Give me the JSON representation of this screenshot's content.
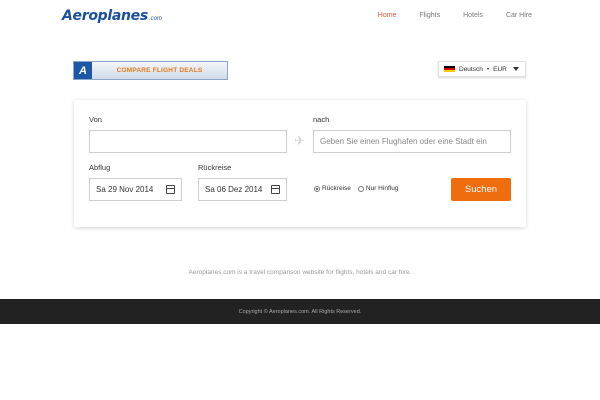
{
  "header": {
    "logo_main": "Aeroplanes",
    "logo_domain": ".com",
    "nav": [
      {
        "label": "Home",
        "active": true
      },
      {
        "label": "Flights",
        "active": false
      },
      {
        "label": "Hotels",
        "active": false
      },
      {
        "label": "Car Hire",
        "active": false
      }
    ]
  },
  "banner": {
    "logo_letter": "A",
    "text": "COMPARE FLIGHT DEALS"
  },
  "language": {
    "label": "Deutsch",
    "separator": "•",
    "currency": "EUR",
    "flag_colors": [
      "#000000",
      "#dd0000",
      "#ffce00"
    ]
  },
  "form": {
    "from_label": "Von",
    "from_value": "",
    "to_label": "nach",
    "to_placeholder": "Geben Sie einen Flughafen oder eine Stadt ein",
    "depart_label": "Abflug",
    "depart_value": "Sa 29 Nov 2014",
    "return_label": "Rückreise",
    "return_value": "Sa 06 Dez 2014",
    "trip_options": [
      {
        "label": "Rückreise",
        "selected": true
      },
      {
        "label": "Nur Hinflug",
        "selected": false
      }
    ],
    "search_label": "Suchen"
  },
  "tagline": "Aeroplanes.com is a travel comparison website for flights, hotels and car hire.",
  "footer": {
    "copyright": "Copyright © Aeroplanes.com. All Rights Reserved."
  },
  "colors": {
    "accent": "#ef6c0f",
    "brand": "#1a4f9c",
    "nav_active": "#e8503a",
    "footer_bg": "#222222"
  }
}
